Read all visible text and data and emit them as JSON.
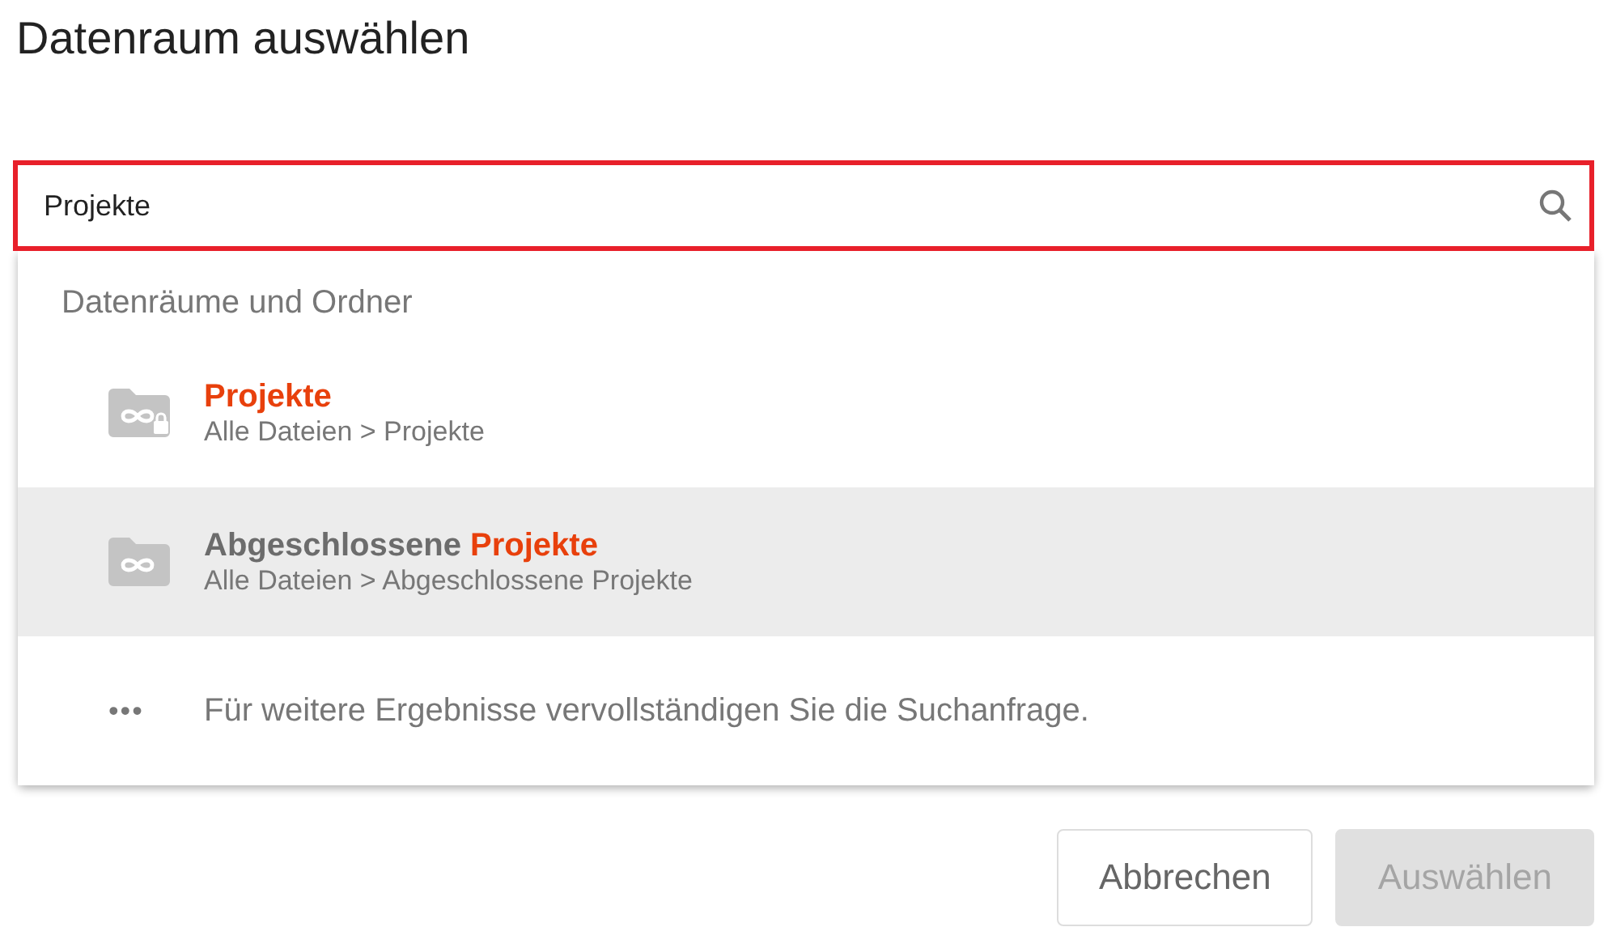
{
  "dialog": {
    "title": "Datenraum auswählen"
  },
  "search": {
    "value": "Projekte",
    "highlighted": true
  },
  "results": {
    "heading": "Datenräume und Ordner",
    "items": [
      {
        "title_match": "Projekte",
        "path": "Alle Dateien > Projekte",
        "locked": true,
        "selected": false
      },
      {
        "title_prefix": "Abgeschlossene ",
        "title_match": "Projekte",
        "path": "Alle Dateien > Abgeschlossene Projekte",
        "locked": false,
        "selected": true
      }
    ],
    "more": {
      "icon": "•••",
      "text": "Für weitere Ergebnisse vervollständigen Sie die Suchanfrage."
    }
  },
  "buttons": [
    {
      "label": "Abbrechen",
      "disabled": false
    },
    {
      "label": "Auswählen",
      "disabled": true
    }
  ]
}
